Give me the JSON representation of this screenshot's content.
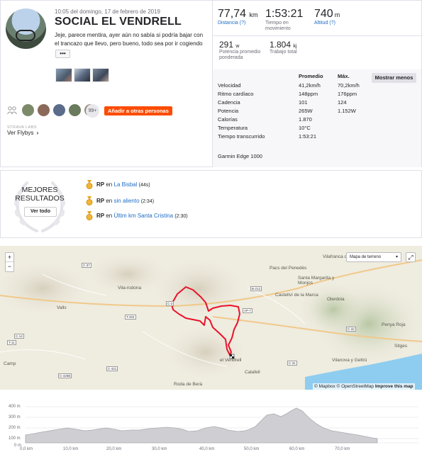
{
  "activity": {
    "date": "10:05 del domingo, 17 de febrero de 2019",
    "title": "SOCIAL EL VENDRELL",
    "description": "Jeje, parece mentira, ayer aún no sabía si podría bajar con el trancazo que llevo, pero bueno, todo sea por ir cogiendo",
    "more_label": "•••"
  },
  "social": {
    "more_count": "99+",
    "add_others_label": "Añadir a otras personas",
    "labs_label": "STRAVA LABS",
    "flybys_label": "Ver Flybys",
    "flybys_chevron": "›"
  },
  "stats": {
    "distance_value": "77,74",
    "distance_unit": "km",
    "distance_label": "Distancia (?)",
    "moving_time_value": "1:53:21",
    "moving_time_label": "Tiempo en movimiento",
    "elevation_value": "740",
    "elevation_unit": "m",
    "elevation_label": "Altitud (?)",
    "power_value": "291",
    "power_unit": "w",
    "power_label": "Potencia promedio ponderada",
    "work_value": "1.804",
    "work_unit": "kj",
    "work_label": "Trabajo total"
  },
  "details": {
    "headers": [
      "",
      "Promedio",
      "Máx."
    ],
    "show_less_label": "Mostrar menos",
    "rows": [
      [
        "Velocidad",
        "41,2km/h",
        "70,2km/h"
      ],
      [
        "Ritmo cardíaco",
        "148ppm",
        "176ppm"
      ],
      [
        "Cadencia",
        "101",
        "124"
      ],
      [
        "Potencia",
        "265W",
        "1.152W"
      ],
      [
        "Calorías",
        "1.870",
        ""
      ],
      [
        "Temperatura",
        "10°C",
        ""
      ],
      [
        "Tiempo transcurrido",
        "1:53:21",
        ""
      ]
    ],
    "device": "Garmin Edge 1000"
  },
  "best_results": {
    "title": "MEJORES RESULTADOS",
    "see_all_label": "Ver todo",
    "items": [
      {
        "prefix": "RP",
        "en": "en",
        "segment": "La Bisbal",
        "time": "(44s)"
      },
      {
        "prefix": "RP",
        "en": "en",
        "segment": "sin aliento",
        "time": "(2:34)"
      },
      {
        "prefix": "RP",
        "en": "en",
        "segment": "Últim km Santa Cristina",
        "time": "(2:30)"
      }
    ]
  },
  "map": {
    "zoom_in": "+",
    "zoom_out": "−",
    "map_type_label": "Mapa de terreno",
    "map_type_caret": "▾",
    "fullscreen_icon": "⤢",
    "attribution": "© Mapbox © OpenStreetMap",
    "improve_label": "Improve this map",
    "towns": [
      "Vilafranca del Penedès",
      "Vila-rodona",
      "Valls",
      "Santa Margarita y Monjos",
      "Castellví de la Marca",
      "Pacs del Penedès",
      "Olerdola",
      "Penya Roja",
      "Sitges",
      "Vilanova y Geltrú",
      "el Vendrell",
      "Calafell",
      "Roda de Berà",
      "Camp"
    ],
    "roads": [
      "C-37",
      "B-212",
      "AP-7",
      "C-2",
      "T-204",
      "C-14",
      "C-421",
      "C-32",
      "C-31",
      "T-11",
      "C-420B"
    ]
  },
  "elevation": {
    "y_labels": [
      "400 m",
      "300 m",
      "200 m",
      "100 m",
      "0 m"
    ],
    "x_labels": [
      "0,0 km",
      "10,0 km",
      "20,0 km",
      "30,0 km",
      "40,0 km",
      "50,0 km",
      "60,0 km",
      "70,0 km"
    ]
  },
  "colors": {
    "accent": "#fc4c02",
    "link": "#1f6dc4",
    "route": "#e8132a",
    "elevation_fill": "#cfcfd3"
  }
}
